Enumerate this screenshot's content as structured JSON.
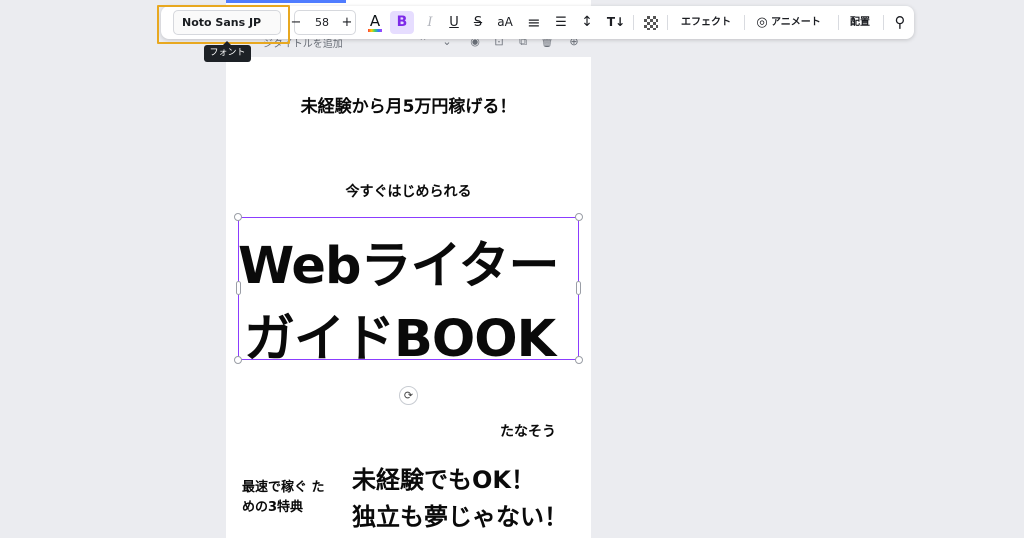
{
  "toolbar": {
    "font_name": "Noto Sans JP",
    "font_size": "58",
    "minus": "−",
    "plus": "+",
    "color_glyph": "A",
    "bold": "B",
    "italic": "I",
    "underline": "U",
    "strike": "S",
    "case": "aA",
    "align_glyph": "≡",
    "list_glyph": "☰",
    "spacing_glyph": "↕",
    "vertical_glyph": "T↓",
    "effects_label": "エフェクト",
    "animate_label": "アニメート",
    "arrange_label": "配置",
    "paint_glyph": "⚲",
    "accent_color": "#7d2ae8",
    "highlight_color": "#e8a820"
  },
  "tooltip": {
    "text": "フォント"
  },
  "page_header": {
    "title": "ジタイトルを追加"
  },
  "canvas": {
    "line1": "未経験から月5万円稼げる！",
    "line2": "今すぐはじめられる",
    "headline1": "Webライター",
    "headline2": "ガイドBOOK",
    "author": "たなそう",
    "bonus_label": "最速で稼ぐ ための3特典",
    "promo1": "未経験でもOK！",
    "promo2": "独立も夢じゃない！",
    "selection_color": "#8b3dff"
  }
}
